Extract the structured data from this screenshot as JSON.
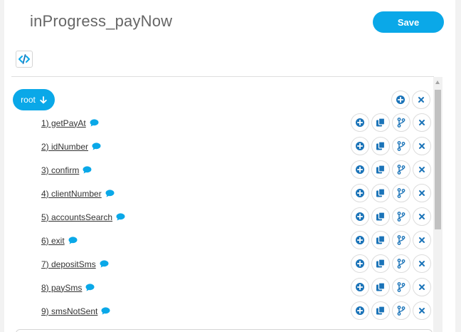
{
  "header": {
    "title": "inProgress_payNow",
    "save_label": "Save"
  },
  "toolbar": {
    "code_icon": "code-icon"
  },
  "tree": {
    "root_label": "root",
    "items": [
      {
        "label": "1) getPayAt"
      },
      {
        "label": "2) idNumber"
      },
      {
        "label": "3) confirm"
      },
      {
        "label": "4) clientNumber"
      },
      {
        "label": "5) accountsSearch"
      },
      {
        "label": "6) exit"
      },
      {
        "label": "7) depositSms"
      },
      {
        "label": "8) paySms"
      },
      {
        "label": "9) smsNotSent"
      }
    ]
  },
  "colors": {
    "accent": "#0aa8e8",
    "icon": "#1a73b8"
  }
}
